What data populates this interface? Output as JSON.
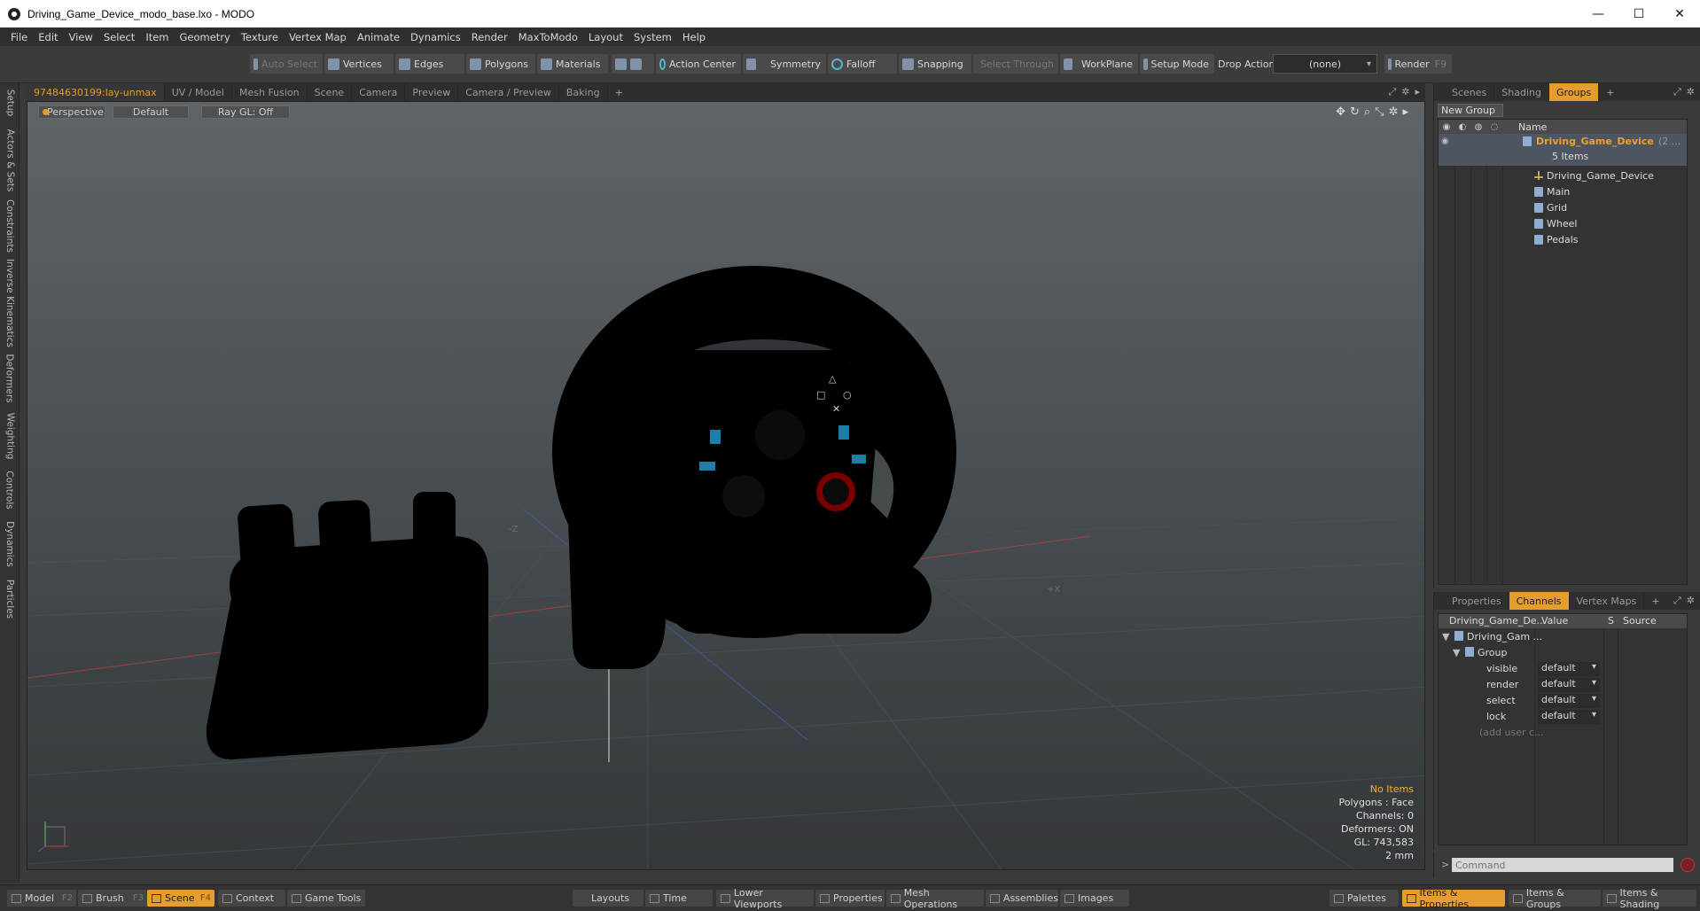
{
  "window": {
    "title": "Driving_Game_Device_modo_base.lxo - MODO",
    "minimize": "—",
    "maximize": "☐",
    "close": "✕"
  },
  "menu": [
    "File",
    "Edit",
    "View",
    "Select",
    "Item",
    "Geometry",
    "Texture",
    "Vertex Map",
    "Animate",
    "Dynamics",
    "Render",
    "MaxToModo",
    "Layout",
    "System",
    "Help"
  ],
  "toolbar": {
    "auto_select": "Auto Select",
    "vertices": "Vertices",
    "edges": "Edges",
    "polygons": "Polygons",
    "materials": "Materials",
    "action_center": "Action Center",
    "symmetry": "Symmetry",
    "falloff": "Falloff",
    "snapping": "Snapping",
    "select_through": "Select Through",
    "workplane": "WorkPlane",
    "setup_mode": "Setup Mode",
    "drop_action_label": "Drop Action",
    "drop_action_value": "(none)",
    "render": "Render",
    "render_key": "F9"
  },
  "left_tabs": [
    "Setup",
    "Actors & Sets",
    "Constraints",
    "Inverse Kinematics",
    "Deformers",
    "Weighting",
    "Controls",
    "Dynamics",
    "Particles"
  ],
  "viewport_tabs": [
    "97484630199:lay-unmax",
    "UV / Model",
    "Mesh Fusion",
    "Scene",
    "Camera",
    "Preview",
    "Camera / Preview",
    "Baking",
    "+"
  ],
  "viewport": {
    "view_mode": "Perspective",
    "shading": "Default",
    "raygl": "Ray GL: Off",
    "axis_neg_z": "-Z",
    "axis_pos_x": "+X",
    "info": {
      "items": "No Items",
      "polygons": "Polygons : Face",
      "channels": "Channels: 0",
      "deformers": "Deformers: ON",
      "gl": "GL: 743,583",
      "grid": "2 mm"
    }
  },
  "top_panel": {
    "tabs": [
      "Scenes",
      "Shading",
      "Groups",
      "+"
    ],
    "active_tab": "Groups",
    "new_group": "New Group",
    "name_header": "Name",
    "group_name": "Driving_Game_Device",
    "group_suffix": "(2 ...",
    "group_count": "5 Items",
    "items": [
      "Driving_Game_Device",
      "Main",
      "Grid",
      "Wheel",
      "Pedals"
    ]
  },
  "bottom_panel": {
    "tabs": [
      "Properties",
      "Channels",
      "Vertex Maps",
      "+"
    ],
    "active_tab": "Channels",
    "headers": {
      "name": "Driving_Game_De...",
      "value": "Value",
      "s": "S",
      "source": "Source"
    },
    "root": "Driving_Gam ...",
    "group": "Group",
    "channels": [
      {
        "name": "visible",
        "value": "default"
      },
      {
        "name": "render",
        "value": "default"
      },
      {
        "name": "select",
        "value": "default"
      },
      {
        "name": "lock",
        "value": "default"
      }
    ],
    "add_user": "(add user c..."
  },
  "command": {
    "prompt": ">",
    "placeholder": "Command"
  },
  "bottom_bar": {
    "model": "Model",
    "model_key": "F2",
    "brush": "Brush",
    "brush_key": "F3",
    "scene": "Scene",
    "scene_key": "F4",
    "context": "Context",
    "game_tools": "Game Tools",
    "layouts": "Layouts",
    "time": "Time",
    "lower_viewports": "Lower Viewports",
    "properties": "Properties",
    "mesh_operations": "Mesh Operations",
    "assemblies": "Assemblies",
    "images": "Images",
    "palettes": "Palettes",
    "items_properties": "Items & Properties",
    "items_groups": "Items & Groups",
    "items_shading": "Items & Shading"
  },
  "colors": {
    "accent": "#e59d2e",
    "selection": "#4c5560"
  }
}
